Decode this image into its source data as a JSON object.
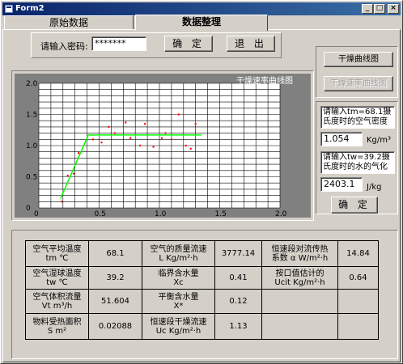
{
  "window": {
    "title": "Form2"
  },
  "titlebar_buttons": {
    "minimize": "_",
    "maximize": "□",
    "close": "×"
  },
  "tabs": [
    {
      "label": "原始数据"
    },
    {
      "label": "数据整理"
    }
  ],
  "password": {
    "label": "请输入密码:",
    "value": "*******",
    "confirm": "确 定",
    "exit": "退 出"
  },
  "chart_buttons": {
    "drying_curve": "干燥曲线图",
    "rate_curve": "干燥速率曲线图"
  },
  "air_density": {
    "prompt": "请输入tm=68.1摄氏度时的空气密度",
    "value": "1.054",
    "unit": "Kg/m³"
  },
  "vaporization_heat": {
    "prompt": "请输入tw=39.2摄氏度时的水的气化",
    "value": "2403.1",
    "unit": "J/kg"
  },
  "confirm2": "确 定",
  "results": {
    "rows": [
      [
        {
          "label": "空气平均温度",
          "sub": "tm ℃"
        },
        "68.1",
        {
          "label": "空气的质量流速",
          "sub": "L Kg/m²·h"
        },
        "3777.14",
        {
          "label": "恒速段对流传热",
          "sub": "系数 α W/m²·h"
        },
        "14.84"
      ],
      [
        {
          "label": "空气湿球温度",
          "sub": "tw ℃"
        },
        "39.2",
        {
          "label": "临界含水量",
          "sub": "Xc"
        },
        "0.41",
        {
          "label": "按口值估计的",
          "sub": "Ucit Kg/m²·h"
        },
        "0.64"
      ],
      [
        {
          "label": "空气体积流量",
          "sub": "Vt m³/h"
        },
        "51.604",
        {
          "label": "平衡含水量",
          "sub": "X*"
        },
        "0.12",
        {
          "label": "",
          "sub": ""
        },
        ""
      ],
      [
        {
          "label": "物料受热面积",
          "sub": "S m²"
        },
        "0.02088",
        {
          "label": "恒速段干燥流速",
          "sub": "Uc Kg/m²·h"
        },
        "1.13",
        {
          "label": "",
          "sub": ""
        },
        ""
      ]
    ]
  },
  "chart_data": {
    "type": "scatter",
    "title": "干燥速率曲线图",
    "xlim": [
      0,
      2.0
    ],
    "ylim": [
      0,
      2.0
    ],
    "x_ticks": [
      "0",
      "0.5",
      "1.0",
      "1.5",
      "2.0"
    ],
    "y_ticks": [
      "0",
      "0.5",
      "1.0",
      "1.5",
      "2.0"
    ],
    "fit_line": {
      "x": [
        0.18,
        0.41,
        1.35
      ],
      "y": [
        0.15,
        1.17,
        1.17
      ],
      "color": "#00ff00"
    },
    "points": {
      "color": "#ff0000",
      "x": [
        0.19,
        0.24,
        0.29,
        0.33,
        0.45,
        0.52,
        0.58,
        0.63,
        0.72,
        0.76,
        0.84,
        0.88,
        0.95,
        1.02,
        1.05,
        1.1,
        1.16,
        1.22,
        1.26,
        1.3
      ],
      "y": [
        0.1,
        0.52,
        0.55,
        0.88,
        1.1,
        1.05,
        1.3,
        1.2,
        1.37,
        1.12,
        1.0,
        1.35,
        0.98,
        1.12,
        1.2,
        1.1,
        1.5,
        1.0,
        0.95,
        1.35
      ]
    }
  }
}
